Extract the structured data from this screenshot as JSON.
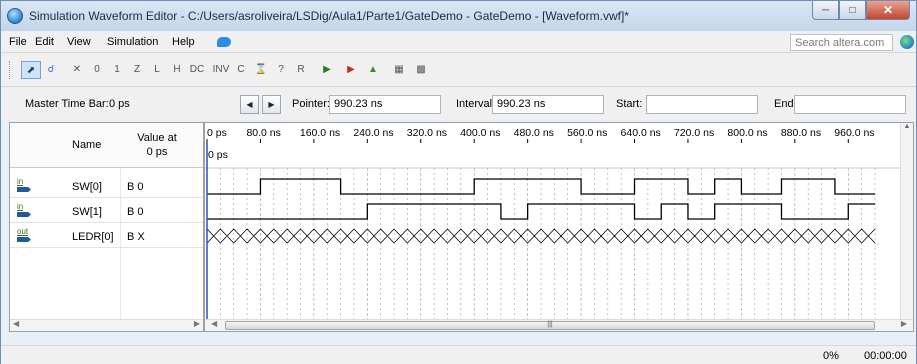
{
  "window": {
    "title": "Simulation Waveform Editor - C:/Users/asroliveira/LSDig/Aula1/Parte1/GateDemo - GateDemo - [Waveform.vwf]*",
    "controls": [
      "minimize-icon",
      "maximize-icon",
      "close-icon"
    ]
  },
  "menu": {
    "items": [
      "File",
      "Edit",
      "View",
      "Simulation",
      "Help"
    ],
    "search_placeholder": "Search altera.com"
  },
  "toolbar": {
    "icons": [
      "pointer-tool-icon",
      "zoom-tool-icon",
      "forcing-unknown-icon",
      "forcing-low-icon",
      "forcing-high-icon",
      "high-impedance-icon",
      "weak-low-icon",
      "weak-high-icon",
      "dont-care-icon",
      "invert-icon",
      "count-value-icon",
      "clock-icon",
      "arbitrary-value-icon",
      "random-value-icon",
      "run-functional-simulation-icon",
      "run-timing-simulation-icon",
      "generate-netlist-icon",
      "grid-settings-icon",
      "snap-to-grid-icon"
    ],
    "active": "pointer-tool-icon"
  },
  "timebar": {
    "master_label": "Master Time Bar:",
    "master_value": "0 ps",
    "pointer_label": "Pointer:",
    "pointer_value": "990.23 ns",
    "interval_label": "Interval:",
    "interval_value": "990.23 ns",
    "start_label": "Start:",
    "start_value": "",
    "end_label": "End:",
    "end_value": ""
  },
  "signals_panel": {
    "col_name": "Name",
    "col_value_l1": "Value at",
    "col_value_l2": "0 ps",
    "signals": [
      {
        "direction": "in",
        "name": "SW[0]",
        "value": "B 0"
      },
      {
        "direction": "in",
        "name": "SW[1]",
        "value": "B 0"
      },
      {
        "direction": "out",
        "name": "LEDR[0]",
        "value": "B X"
      }
    ]
  },
  "waveform": {
    "ticks": [
      "0 ps",
      "80.0 ns",
      "160.0 ns",
      "240.0 ns",
      "320.0 ns",
      "400.0 ns",
      "480.0 ns",
      "560.0 ns",
      "640.0 ns",
      "720.0 ns",
      "800.0 ns",
      "880.0 ns",
      "960.0 ns"
    ],
    "cursor_label": "0 ps",
    "time_max_ns": 1000,
    "sw0": [
      [
        0,
        0
      ],
      [
        80,
        1
      ],
      [
        200,
        0
      ],
      [
        400,
        1
      ],
      [
        560,
        0
      ],
      [
        640,
        1
      ],
      [
        720,
        0
      ],
      [
        760,
        1
      ],
      [
        800,
        0
      ],
      [
        860,
        1
      ],
      [
        940,
        0
      ],
      [
        1000,
        0
      ]
    ],
    "sw1": [
      [
        0,
        0
      ],
      [
        240,
        1
      ],
      [
        440,
        0
      ],
      [
        480,
        1
      ],
      [
        640,
        0
      ],
      [
        680,
        1
      ],
      [
        720,
        0
      ],
      [
        760,
        1
      ],
      [
        860,
        0
      ],
      [
        960,
        1
      ],
      [
        1000,
        1
      ]
    ],
    "ledr0": "X",
    "grid_color": "#9a9a9a",
    "wave_color": "#000000"
  },
  "statusbar": {
    "progress": "0%",
    "elapsed": "00:00:00"
  }
}
